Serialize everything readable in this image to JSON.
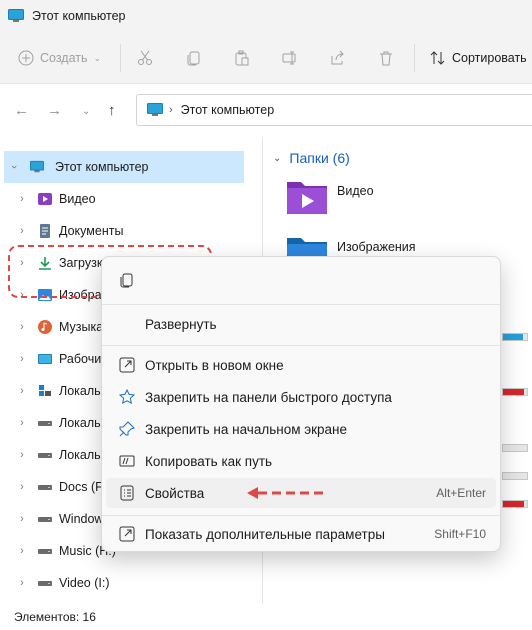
{
  "window": {
    "title": "Этот компьютер"
  },
  "toolbar": {
    "create_label": "Создать",
    "sort_label": "Сортировать",
    "icons": [
      "cut-icon",
      "copy-icon",
      "paste-icon",
      "rename-icon",
      "share-icon",
      "delete-icon"
    ]
  },
  "address": {
    "location": "Этот компьютер"
  },
  "sidebar": {
    "items": [
      {
        "label": "Этот компьютер",
        "icon": "pc-icon"
      },
      {
        "label": "Видео",
        "icon": "video-folder-icon"
      },
      {
        "label": "Документы",
        "icon": "documents-icon"
      },
      {
        "label": "Загрузки",
        "icon": "downloads-icon"
      },
      {
        "label": "Изображения",
        "icon": "pictures-icon"
      },
      {
        "label": "Музыка",
        "icon": "music-icon"
      },
      {
        "label": "Рабочий стол",
        "icon": "desktop-icon"
      },
      {
        "label": "Локальный диск (C:)",
        "icon": "windows-drive-icon"
      },
      {
        "label": "Локальный диск (D:)",
        "icon": "drive-icon"
      },
      {
        "label": "Локальный диск (E:)",
        "icon": "drive-icon"
      },
      {
        "label": "Docs (F:)",
        "icon": "drive-icon"
      },
      {
        "label": "Windows (G:)",
        "icon": "drive-icon"
      },
      {
        "label": "Music (H:)",
        "icon": "drive-icon"
      },
      {
        "label": "Video (I:)",
        "icon": "drive-icon"
      }
    ]
  },
  "content": {
    "group_label": "Папки (6)",
    "folders": [
      {
        "label": "Видео"
      },
      {
        "label": "Изображения"
      }
    ]
  },
  "drives_usage": [
    0.82,
    0.86,
    0.0,
    0.0,
    0.86
  ],
  "context_menu": {
    "expand": "Развернуть",
    "open_new_window": "Открыть в новом окне",
    "pin_quick_access": "Закрепить на панели быстрого доступа",
    "pin_start": "Закрепить на начальном экране",
    "copy_path": "Копировать как путь",
    "properties": "Свойства",
    "properties_shortcut": "Alt+Enter",
    "more_options": "Показать дополнительные параметры",
    "more_options_shortcut": "Shift+F10"
  },
  "status": {
    "items_count": "Элементов: 16"
  },
  "colors": {
    "accent": "#0067c0",
    "selection": "#cce8ff",
    "annotation": "#e04848",
    "drive_full": "#d9252b",
    "drive_ok": "#26a0da"
  }
}
